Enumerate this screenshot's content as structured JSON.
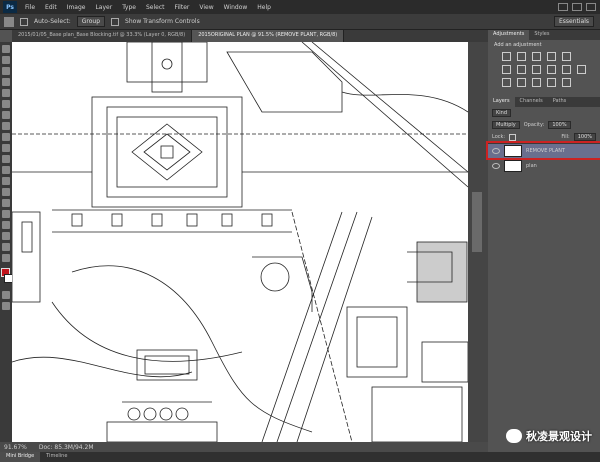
{
  "menu": {
    "app_icon": "Ps",
    "items": [
      "File",
      "Edit",
      "Image",
      "Layer",
      "Type",
      "Select",
      "Filter",
      "View",
      "Window",
      "Help"
    ]
  },
  "options": {
    "auto_select_label": "Auto-Select:",
    "auto_select_value": "Group",
    "show_transform_label": "Show Transform Controls",
    "workspace": "Essentials"
  },
  "document_tabs": [
    {
      "label": "2015/01/05_Base plan_Base Blocking.tif @ 33.3% (Layer 0, RGB/8)",
      "active": false
    },
    {
      "label": "2015ORIGINAL PLAN @ 91.5% (REMOVE PLANT, RGB/8)",
      "active": true
    }
  ],
  "status": {
    "zoom": "91.67%",
    "doc": "Doc: 85.3M/94.2M"
  },
  "bottom_tabs": [
    "Mini Bridge",
    "Timeline"
  ],
  "panels": {
    "top_tabs": [
      "Adjustments",
      "Styles"
    ],
    "adjustments_label": "Add an adjustment",
    "layer_tabs": [
      "Layers",
      "Channels",
      "Paths"
    ],
    "kind_label": "Kind",
    "blend_mode": "Multiply",
    "opacity_label": "Opacity:",
    "opacity_value": "100%",
    "lock_label": "Lock:",
    "fill_label": "Fill:",
    "fill_value": "100%",
    "layers": [
      {
        "name": "REMOVE PLANT",
        "selected": true
      },
      {
        "name": "plan",
        "selected": false
      }
    ]
  },
  "watermark": {
    "text": "秋凌景观设计"
  }
}
